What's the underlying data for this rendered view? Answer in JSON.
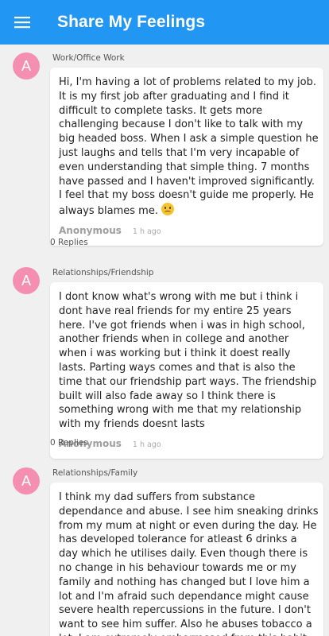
{
  "app": {
    "title": "Share My Feelings",
    "accent_color": "#2196f3",
    "menu_icon": "hamburger-menu-icon"
  },
  "posts": [
    {
      "avatar_letter": "A",
      "category": "Work/Office Work",
      "body": "Hi, I'm having a lot of problems related to my job. It is my first job after graduating and I find it difficult to complete tasks. It gets more challenging because I don't like to talk with my big headed boss. When I ask a simple question he just laughs and tells that I'm very incapable of even understanding that simple thing. 7 months have passed and I haven't improved significantly. I feel that my boss doesn't guide me properly. He always blames me.",
      "emoji": "sad-face",
      "author": "Anonymous",
      "time": "1 h ago",
      "replies": "0 Replies"
    },
    {
      "avatar_letter": "A",
      "category": "Relationships/Friendship",
      "body": "I dont know what's wrong with me but i think i dont have real friends for my entire 25 years here. I've got friends when i was in high school, another friends when in college and another when i was working but i think it doest really lasts. Parting ways comes and that is also the time that our friendship part ways. The friendship built will also fade away so I think there is something wrong with me that my relationship with my friends doesnt lasts",
      "author": "Anonymous",
      "time": "1 h ago",
      "replies": "0 Replies"
    },
    {
      "avatar_letter": "A",
      "category": "Relationships/Family",
      "body": "I think my dad suffers from substance dependance and abuse. I see him sneaking drinks from my mum at night or even during the day. He has developed tolerance for atleast 6 drinks a day which he utilises daily. Even though there is no change in his behaviour towards me or my family and nothing has changed but I love him a lot and I'm afraid such dependance might cause severe health repercussions in the future. I don't want to see him suffer. Also he abuses tobacco a lot. I am extremely embarrassed from this habit of him. But the thought"
    }
  ]
}
